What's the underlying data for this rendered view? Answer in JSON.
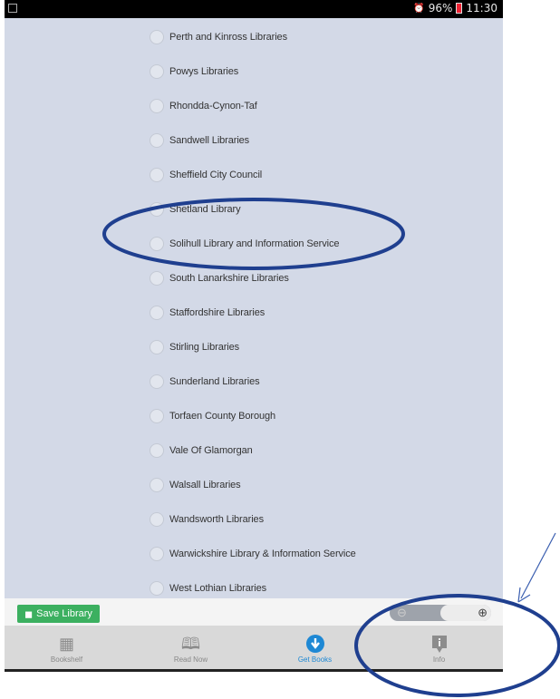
{
  "status_bar": {
    "battery": "96%",
    "time": "11:30"
  },
  "libraries": [
    {
      "label": "Perth and Kinross Libraries"
    },
    {
      "label": "Powys Libraries"
    },
    {
      "label": "Rhondda-Cynon-Taf"
    },
    {
      "label": "Sandwell Libraries"
    },
    {
      "label": "Sheffield City Council"
    },
    {
      "label": "Shetland Library"
    },
    {
      "label": "Solihull Library and Information Service"
    },
    {
      "label": "South Lanarkshire Libraries"
    },
    {
      "label": "Staffordshire Libraries"
    },
    {
      "label": "Stirling Libraries"
    },
    {
      "label": "Sunderland Libraries"
    },
    {
      "label": "Torfaen County Borough"
    },
    {
      "label": "Vale Of Glamorgan"
    },
    {
      "label": "Walsall Libraries"
    },
    {
      "label": "Wandsworth Libraries"
    },
    {
      "label": "Warwickshire Library & Information Service"
    },
    {
      "label": "West Lothian Libraries"
    }
  ],
  "toolbar": {
    "save_label": "Save Library"
  },
  "tabs": [
    {
      "label": "Bookshelf",
      "icon": "bookshelf-icon"
    },
    {
      "label": "Read Now",
      "icon": "book-icon"
    },
    {
      "label": "Get Books",
      "icon": "download-icon"
    },
    {
      "label": "Info",
      "icon": "info-icon"
    }
  ],
  "colors": {
    "accent": "#1e88d4",
    "save_button": "#3cb060",
    "annotation": "#1f3f8f"
  }
}
